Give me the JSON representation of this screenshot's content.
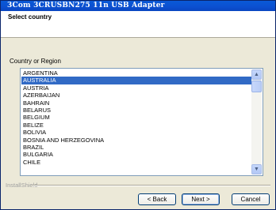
{
  "window": {
    "title": "3Com 3CRUSBN275 11n USB Adapter"
  },
  "header": {
    "title": "Select country"
  },
  "group": {
    "label": "Country or Region"
  },
  "countries": [
    "ARGENTINA",
    "AUSTRALIA",
    "AUSTRIA",
    "AZERBAIJAN",
    "BAHRAIN",
    "BELARUS",
    "BELGIUM",
    "BELIZE",
    "BOLIVIA",
    "BOSNIA AND HERZEGOVINA",
    "BRAZIL",
    "BULGARIA",
    "CHILE"
  ],
  "selected_country": "AUSTRALIA",
  "footer": {
    "brand": "InstallShield"
  },
  "buttons": {
    "back": "< Back",
    "next": "Next >",
    "cancel": "Cancel"
  },
  "icons": {
    "scroll_up": "scroll-up-arrow-icon",
    "scroll_down": "scroll-down-arrow-icon"
  }
}
